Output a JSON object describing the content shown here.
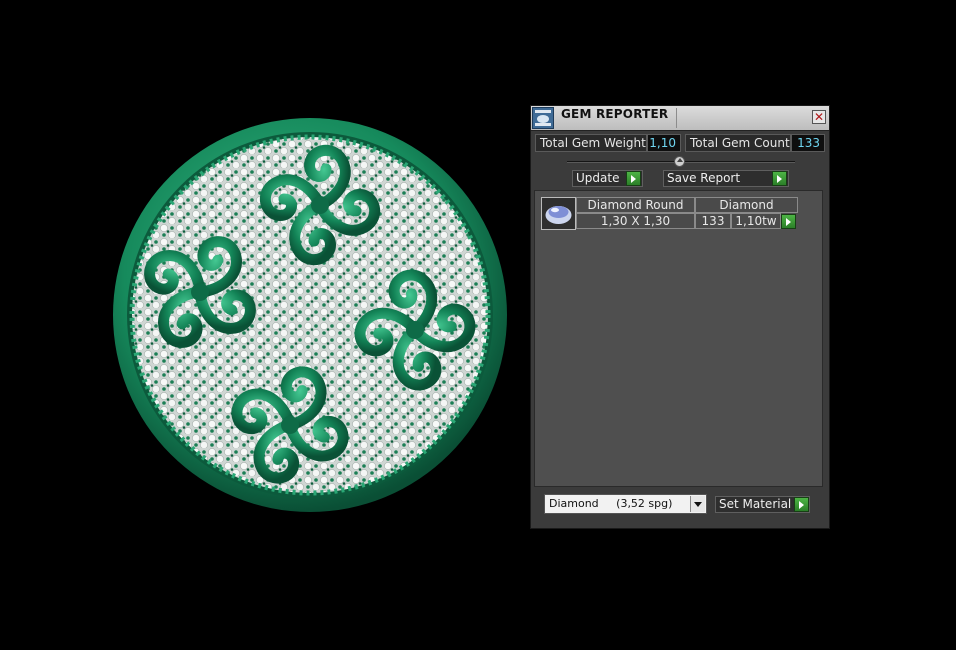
{
  "panel": {
    "title": "GEM REPORTER",
    "close_glyph": "✕",
    "total_weight_label": "Total Gem Weight",
    "total_weight_value": "1,10",
    "total_count_label": "Total Gem Count",
    "total_count_value": "133",
    "update_label": "Update",
    "save_report_label": "Save Report",
    "gem": {
      "shape": "Diamond Round",
      "material": "Diamond",
      "size": "1,30 X 1,30",
      "count": "133",
      "weight": "1,10tw"
    },
    "material_select": "Diamond     (3,52 spg)",
    "set_material_label": "Set Material"
  },
  "icons": {
    "app": "gem-reporter-app-icon",
    "close": "close-icon",
    "play": "play-arrow-icon",
    "dropdown": "chevron-down-icon",
    "gem_thumb": "round-diamond-icon"
  },
  "colors": {
    "metal": "#1a8a5f",
    "background": "#000000",
    "panel": "#3b3b3b",
    "value_text": "#6fd5f0",
    "action_green": "#3a9b33"
  }
}
